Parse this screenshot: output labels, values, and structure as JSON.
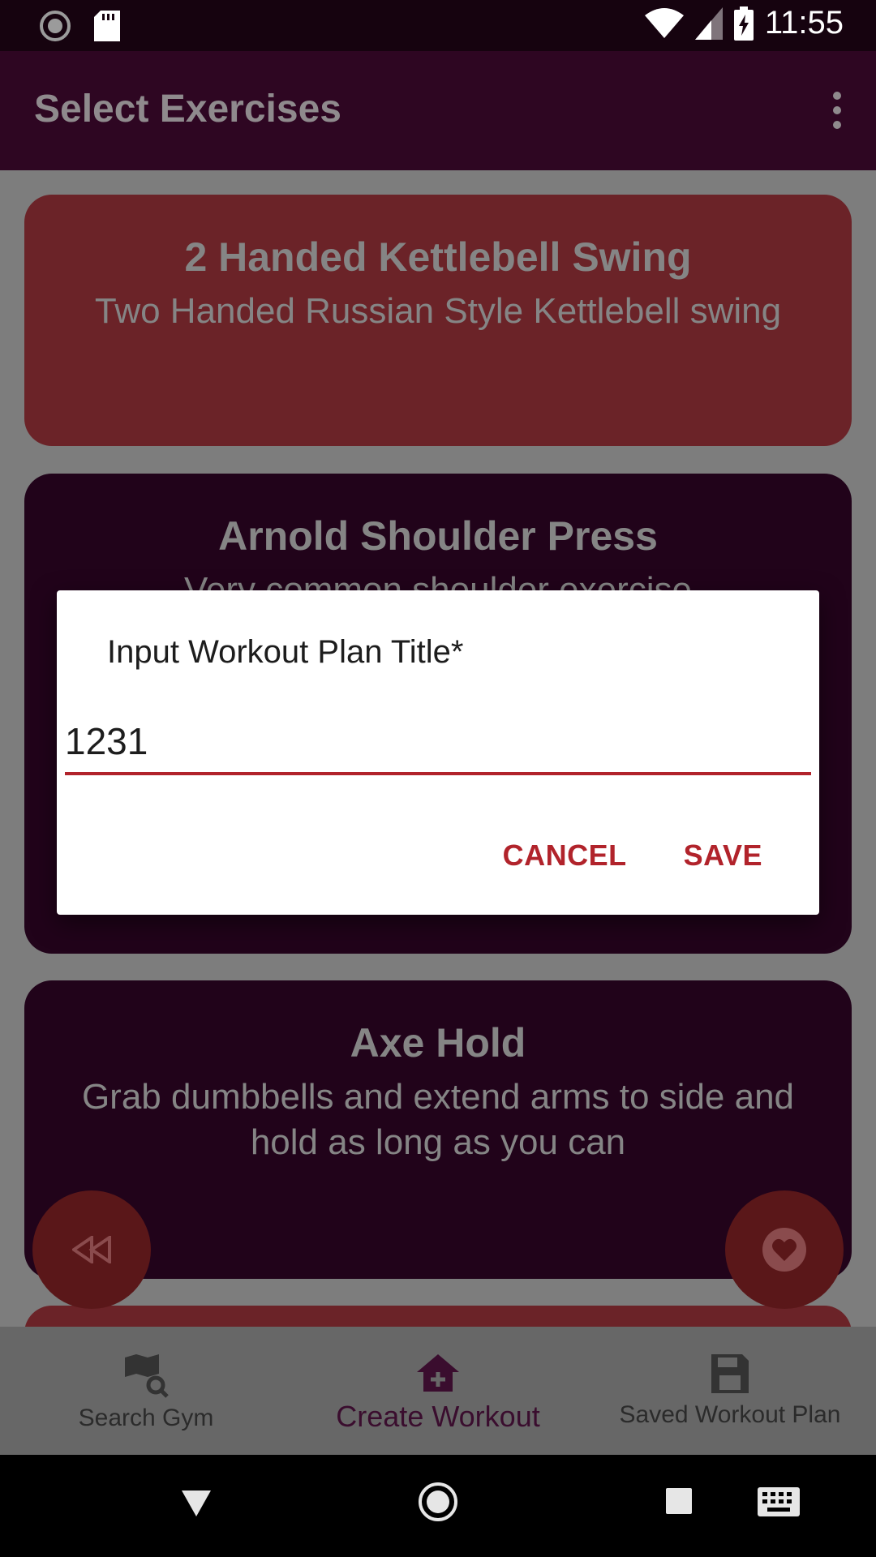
{
  "status_bar": {
    "time": "11:55",
    "icons": [
      "sync-icon",
      "sd-card-icon",
      "wifi-icon",
      "signal-icon",
      "battery-charging-icon"
    ]
  },
  "toolbar": {
    "title": "Select Exercises",
    "menu_icon": "more-vert-icon"
  },
  "exercises": [
    {
      "name": "2 Handed Kettlebell Swing",
      "description": "Two Handed Russian Style Kettlebell swing",
      "color": "#6b2328"
    },
    {
      "name": "Arnold Shoulder Press",
      "description": "Very common shoulder exercise",
      "color": "#21031a"
    },
    {
      "name": "Axe Hold",
      "description": "Grab dumbbells and extend arms to side and hold as long as you can",
      "color": "#21031a"
    }
  ],
  "fabs": {
    "left_icon": "rewind-icon",
    "right_icon": "heart-icon"
  },
  "dialog": {
    "title": "Input Workout Plan Title*",
    "input_value": "1231",
    "cancel_label": "CANCEL",
    "save_label": "SAVE",
    "accent": "#b1232b"
  },
  "bottom_nav": [
    {
      "label": "Search Gym",
      "icon": "map-search-icon",
      "active": false
    },
    {
      "label": "Create Workout",
      "icon": "home-add-icon",
      "active": true
    },
    {
      "label": "Saved Workout Plan",
      "icon": "floppy-disk-icon",
      "active": false
    }
  ],
  "system_nav": [
    "back-icon",
    "home-icon",
    "recents-icon",
    "keyboard-icon"
  ]
}
